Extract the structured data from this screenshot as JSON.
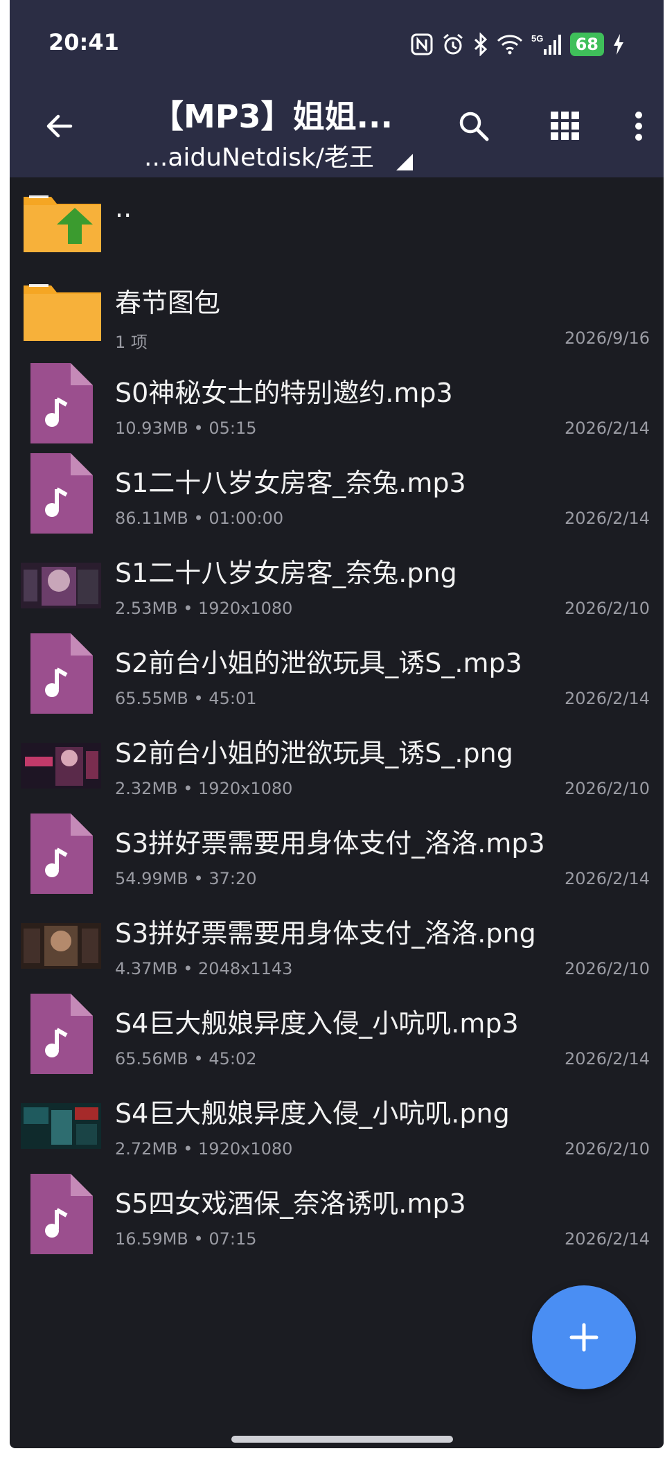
{
  "status_bar": {
    "time": "20:41",
    "network_label": "5G",
    "battery": "68"
  },
  "app_bar": {
    "title": "【MP3】姐姐...",
    "path": "...aiduNetdisk/老王"
  },
  "colors": {
    "app_bar_bg": "#2b2d44",
    "list_bg": "#1b1c22",
    "folder": "#f5a623",
    "audio_file": "#9b4f8e",
    "fab": "#4a8ef3",
    "battery": "#3fbf5a"
  },
  "files": [
    {
      "type": "parent-folder",
      "name": "..",
      "meta": "",
      "date": ""
    },
    {
      "type": "folder",
      "name": "春节图包",
      "meta": "1 项",
      "date": "2026/9/16"
    },
    {
      "type": "audio",
      "name": "S0神秘女士的特别邀约.mp3",
      "size": "10.93MB",
      "detail": "05:15",
      "date": "2026/2/14"
    },
    {
      "type": "audio",
      "name": "S1二十八岁女房客_奈兔.mp3",
      "size": "86.11MB",
      "detail": "01:00:00",
      "date": "2026/2/14"
    },
    {
      "type": "image",
      "name": "S1二十八岁女房客_奈兔.png",
      "size": "2.53MB",
      "detail": "1920x1080",
      "date": "2026/2/10"
    },
    {
      "type": "audio",
      "name": "S2前台小姐的泄欲玩具_诱S_.mp3",
      "size": "65.55MB",
      "detail": "45:01",
      "date": "2026/2/14"
    },
    {
      "type": "image",
      "name": "S2前台小姐的泄欲玩具_诱S_.png",
      "size": "2.32MB",
      "detail": "1920x1080",
      "date": "2026/2/10"
    },
    {
      "type": "audio",
      "name": "S3拼好票需要用身体支付_洛洛.mp3",
      "size": "54.99MB",
      "detail": "37:20",
      "date": "2026/2/14"
    },
    {
      "type": "image",
      "name": "S3拼好票需要用身体支付_洛洛.png",
      "size": "4.37MB",
      "detail": "2048x1143",
      "date": "2026/2/10"
    },
    {
      "type": "audio",
      "name": "S4巨大舰娘异度入侵_小吭叽.mp3",
      "size": "65.56MB",
      "detail": "45:02",
      "date": "2026/2/14"
    },
    {
      "type": "image",
      "name": "S4巨大舰娘异度入侵_小吭叽.png",
      "size": "2.72MB",
      "detail": "1920x1080",
      "date": "2026/2/10"
    },
    {
      "type": "audio",
      "name": "S5四女戏酒保_奈洛诱叽.mp3",
      "size": "16.59MB",
      "detail": "07:15",
      "date": "2026/2/14"
    }
  ],
  "fab": {
    "icon": "plus-icon",
    "label": "+"
  }
}
